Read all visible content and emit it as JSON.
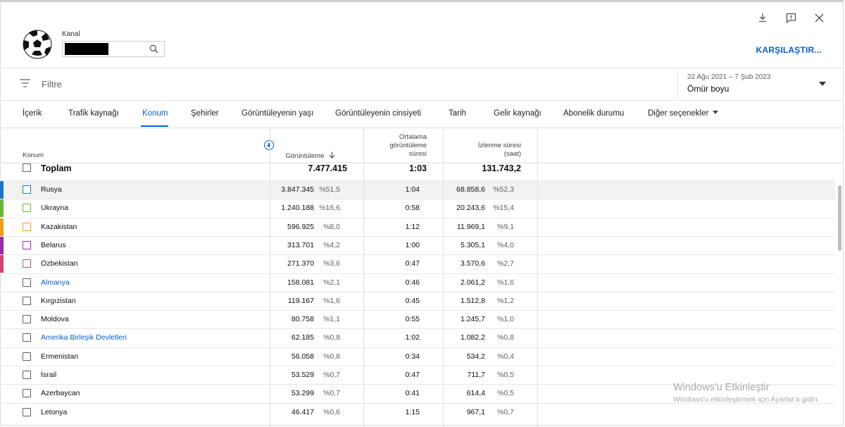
{
  "header": {
    "channel_label": "Kanal",
    "compare_label": "KARŞILAŞTIR...",
    "filter_placeholder": "Filtre",
    "date_range": "22 Ağu 2021 – 7 Şub 2023",
    "date_preset": "Ömür boyu"
  },
  "tabs": [
    {
      "label": "İçerik"
    },
    {
      "label": "Trafik kaynağı"
    },
    {
      "label": "Konum"
    },
    {
      "label": "Şehirler"
    },
    {
      "label": "Görüntüleyenin yaşı"
    },
    {
      "label": "Görüntüleyenin cinsiyeti"
    },
    {
      "label": "Tarih"
    },
    {
      "label": "Gelir kaynağı"
    },
    {
      "label": "Abonelik durumu"
    },
    {
      "label": "Diğer seçenekler"
    }
  ],
  "table": {
    "col_location": "Konum",
    "col_views": "Görüntüleme",
    "col_avg_l1": "Ortalama",
    "col_avg_l2": "görüntüleme",
    "col_avg_l3": "süresi",
    "col_watch_l1": "İzlenme süresi",
    "col_watch_l2": "(saat)",
    "total": {
      "label": "Toplam",
      "views": "7.477.415",
      "avg": "1:03",
      "watch": "131.743,2"
    },
    "rows": [
      {
        "name": "Rusya",
        "views": "3.847.345",
        "views_pct": "%51,5",
        "avg": "1:04",
        "watch": "68.858,6",
        "watch_pct": "%52,3",
        "color": "#1976d2",
        "checkbox_color": "#1976d2",
        "link": false
      },
      {
        "name": "Ukrayna",
        "views": "1.240.188",
        "views_pct": "%16,6",
        "avg": "0:58",
        "watch": "20.243,6",
        "watch_pct": "%15,4",
        "color": "#66bb2a",
        "checkbox_color": "#66bb2a",
        "link": false
      },
      {
        "name": "Kazakistan",
        "views": "596.925",
        "views_pct": "%8,0",
        "avg": "1:12",
        "watch": "11.969,1",
        "watch_pct": "%9,1",
        "color": "#f39c12",
        "checkbox_color": "#f39c12",
        "link": false
      },
      {
        "name": "Belarus",
        "views": "313.701",
        "views_pct": "%4,2",
        "avg": "1:00",
        "watch": "5.305,1",
        "watch_pct": "%4,0",
        "color": "#9c27b0",
        "checkbox_color": "#9c27b0",
        "link": false
      },
      {
        "name": "Özbekistan",
        "views": "271.370",
        "views_pct": "%3,6",
        "avg": "0:47",
        "watch": "3.570,6",
        "watch_pct": "%2,7",
        "color": "#e0406a",
        "checkbox_color": "#e0406a",
        "link": false
      },
      {
        "name": "Almanya",
        "views": "158.081",
        "views_pct": "%2,1",
        "avg": "0:46",
        "watch": "2.061,2",
        "watch_pct": "%1,6",
        "color": "",
        "checkbox_color": "#5f5f5f",
        "link": true
      },
      {
        "name": "Kırgızistan",
        "views": "119.167",
        "views_pct": "%1,6",
        "avg": "0:45",
        "watch": "1.512,8",
        "watch_pct": "%1,2",
        "color": "",
        "checkbox_color": "#5f5f5f",
        "link": false
      },
      {
        "name": "Moldova",
        "views": "80.758",
        "views_pct": "%1,1",
        "avg": "0:55",
        "watch": "1.245,7",
        "watch_pct": "%1,0",
        "color": "",
        "checkbox_color": "#5f5f5f",
        "link": false
      },
      {
        "name": "Amerika Birleşik Devletleri",
        "views": "62.185",
        "views_pct": "%0,8",
        "avg": "1:02",
        "watch": "1.082,2",
        "watch_pct": "%0,8",
        "color": "",
        "checkbox_color": "#5f5f5f",
        "link": true
      },
      {
        "name": "Ermenistan",
        "views": "56.058",
        "views_pct": "%0,8",
        "avg": "0:34",
        "watch": "534,2",
        "watch_pct": "%0,4",
        "color": "",
        "checkbox_color": "#5f5f5f",
        "link": false
      },
      {
        "name": "İsrail",
        "views": "53.529",
        "views_pct": "%0,7",
        "avg": "0:47",
        "watch": "711,7",
        "watch_pct": "%0,5",
        "color": "",
        "checkbox_color": "#5f5f5f",
        "link": false
      },
      {
        "name": "Azerbaycan",
        "views": "53.299",
        "views_pct": "%0,7",
        "avg": "0:41",
        "watch": "614,4",
        "watch_pct": "%0,5",
        "color": "",
        "checkbox_color": "#5f5f5f",
        "link": false
      },
      {
        "name": "Letonya",
        "views": "46.417",
        "views_pct": "%0,6",
        "avg": "1:15",
        "watch": "967,1",
        "watch_pct": "%0,7",
        "color": "",
        "checkbox_color": "#5f5f5f",
        "link": false
      }
    ]
  },
  "watermark": {
    "line1": "Windows'u Etkinleştir",
    "line2": "Windows'u etkinleştirmek için Ayarlar'a gidin."
  }
}
